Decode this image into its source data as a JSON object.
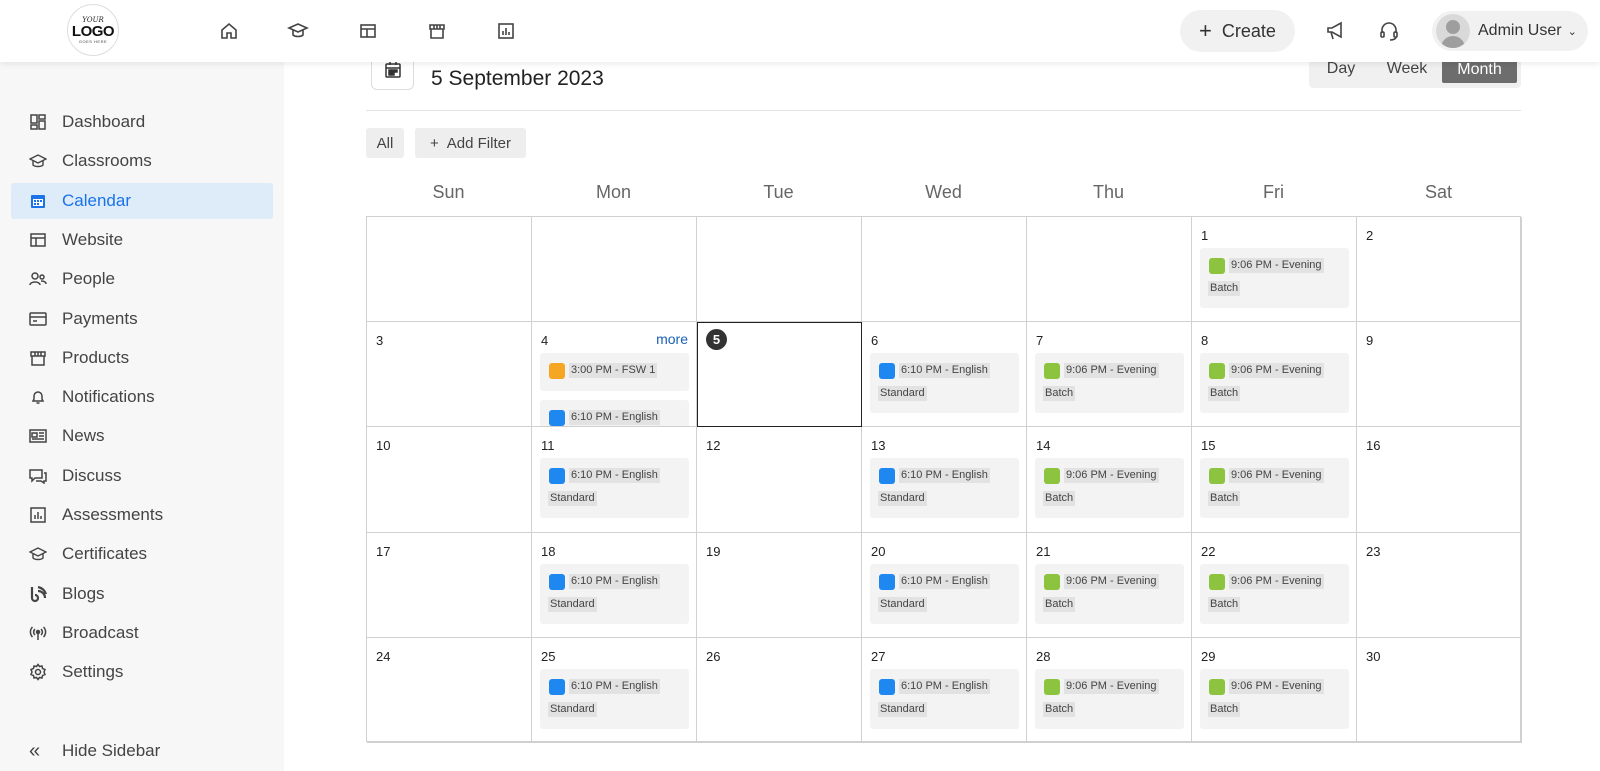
{
  "logo": {
    "line1": "YOUR",
    "line2": "LOGO",
    "line3": "GOES HERE"
  },
  "topnav": [
    "home-icon",
    "classroom-icon",
    "website-icon",
    "store-icon",
    "chart-icon"
  ],
  "header": {
    "create_label": "Create",
    "user_name": "Admin User"
  },
  "sidebar": {
    "items": [
      {
        "label": "Dashboard",
        "icon": "dashboard-icon"
      },
      {
        "label": "Classrooms",
        "icon": "classroom-icon"
      },
      {
        "label": "Calendar",
        "icon": "calendar-icon",
        "active": true
      },
      {
        "label": "Website",
        "icon": "website-icon"
      },
      {
        "label": "People",
        "icon": "people-icon"
      },
      {
        "label": "Payments",
        "icon": "payments-icon"
      },
      {
        "label": "Products",
        "icon": "products-icon"
      },
      {
        "label": "Notifications",
        "icon": "bell-icon"
      },
      {
        "label": "News",
        "icon": "news-icon"
      },
      {
        "label": "Discuss",
        "icon": "discuss-icon"
      },
      {
        "label": "Assessments",
        "icon": "assessments-icon"
      },
      {
        "label": "Certificates",
        "icon": "certificates-icon"
      },
      {
        "label": "Blogs",
        "icon": "blogs-icon"
      },
      {
        "label": "Broadcast",
        "icon": "broadcast-icon"
      },
      {
        "label": "Settings",
        "icon": "settings-icon"
      }
    ],
    "hide_label": "Hide Sidebar"
  },
  "calendar": {
    "current_date": "5 September 2023",
    "views": {
      "day": "Day",
      "week": "Week",
      "month": "Month",
      "active": "Month"
    },
    "filters": {
      "all": "All",
      "add": "Add Filter"
    },
    "weekdays": [
      "Sun",
      "Mon",
      "Tue",
      "Wed",
      "Thu",
      "Fri",
      "Sat"
    ],
    "more_label": "more",
    "colors": {
      "orange": "#f5a623",
      "blue": "#1e88f0",
      "green": "#8cc43f"
    },
    "weeks": [
      [
        {
          "day": ""
        },
        {
          "day": ""
        },
        {
          "day": ""
        },
        {
          "day": ""
        },
        {
          "day": ""
        },
        {
          "day": "1",
          "events": [
            {
              "color": "green",
              "line1": "9:06 PM - Evening",
              "line2": "Batch"
            }
          ]
        },
        {
          "day": "2"
        }
      ],
      [
        {
          "day": "3"
        },
        {
          "day": "4",
          "more": true,
          "events": [
            {
              "color": "orange",
              "line1": "3:00 PM - FSW 1",
              "line2": ""
            },
            {
              "color": "blue",
              "line1": "6:10 PM - English",
              "line2": ""
            }
          ]
        },
        {
          "day": "5",
          "today": true
        },
        {
          "day": "6",
          "events": [
            {
              "color": "blue",
              "line1": "6:10 PM - English",
              "line2": "Standard"
            }
          ]
        },
        {
          "day": "7",
          "events": [
            {
              "color": "green",
              "line1": "9:06 PM - Evening",
              "line2": "Batch"
            }
          ]
        },
        {
          "day": "8",
          "events": [
            {
              "color": "green",
              "line1": "9:06 PM - Evening",
              "line2": "Batch"
            }
          ]
        },
        {
          "day": "9"
        }
      ],
      [
        {
          "day": "10"
        },
        {
          "day": "11",
          "events": [
            {
              "color": "blue",
              "line1": "6:10 PM - English",
              "line2": "Standard"
            }
          ]
        },
        {
          "day": "12"
        },
        {
          "day": "13",
          "events": [
            {
              "color": "blue",
              "line1": "6:10 PM - English",
              "line2": "Standard"
            }
          ]
        },
        {
          "day": "14",
          "events": [
            {
              "color": "green",
              "line1": "9:06 PM - Evening",
              "line2": "Batch"
            }
          ]
        },
        {
          "day": "15",
          "events": [
            {
              "color": "green",
              "line1": "9:06 PM - Evening",
              "line2": "Batch"
            }
          ]
        },
        {
          "day": "16"
        }
      ],
      [
        {
          "day": "17"
        },
        {
          "day": "18",
          "events": [
            {
              "color": "blue",
              "line1": "6:10 PM - English",
              "line2": "Standard"
            }
          ]
        },
        {
          "day": "19"
        },
        {
          "day": "20",
          "events": [
            {
              "color": "blue",
              "line1": "6:10 PM - English",
              "line2": "Standard"
            }
          ]
        },
        {
          "day": "21",
          "events": [
            {
              "color": "green",
              "line1": "9:06 PM - Evening",
              "line2": "Batch"
            }
          ]
        },
        {
          "day": "22",
          "events": [
            {
              "color": "green",
              "line1": "9:06 PM - Evening",
              "line2": "Batch"
            }
          ]
        },
        {
          "day": "23"
        }
      ],
      [
        {
          "day": "24"
        },
        {
          "day": "25",
          "events": [
            {
              "color": "blue",
              "line1": "6:10 PM - English",
              "line2": "Standard"
            }
          ]
        },
        {
          "day": "26"
        },
        {
          "day": "27",
          "events": [
            {
              "color": "blue",
              "line1": "6:10 PM - English",
              "line2": "Standard"
            }
          ]
        },
        {
          "day": "28",
          "events": [
            {
              "color": "green",
              "line1": "9:06 PM - Evening",
              "line2": "Batch"
            }
          ]
        },
        {
          "day": "29",
          "events": [
            {
              "color": "green",
              "line1": "9:06 PM - Evening",
              "line2": "Batch"
            }
          ]
        },
        {
          "day": "30"
        }
      ]
    ]
  }
}
